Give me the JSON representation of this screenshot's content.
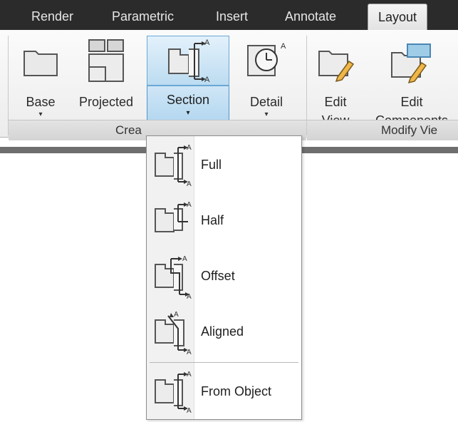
{
  "tabs": [
    "Render",
    "Parametric",
    "Insert",
    "Annotate",
    "Layout"
  ],
  "active_tab": "Layout",
  "ribbon": {
    "create_panel": {
      "title": "Crea",
      "buttons": [
        {
          "label": "Base",
          "caret": "▾"
        },
        {
          "label": "Projected"
        },
        {
          "label": "Section",
          "caret": "▾"
        },
        {
          "label": "Detail",
          "caret": "▾"
        }
      ]
    },
    "modify_panel": {
      "title": "Modify Vie",
      "buttons": [
        {
          "label_line1": "Edit",
          "label_line2": "View"
        },
        {
          "label_line1": "Edit",
          "label_line2": "Components"
        }
      ]
    }
  },
  "section_menu": {
    "items": [
      "Full",
      "Half",
      "Offset",
      "Aligned",
      "From Object"
    ],
    "icon_letter": "A"
  },
  "colors": {
    "tabbar": "#2b2b2b",
    "active_highlight": "#bcdcf1",
    "active_border": "#6aa8d6"
  }
}
